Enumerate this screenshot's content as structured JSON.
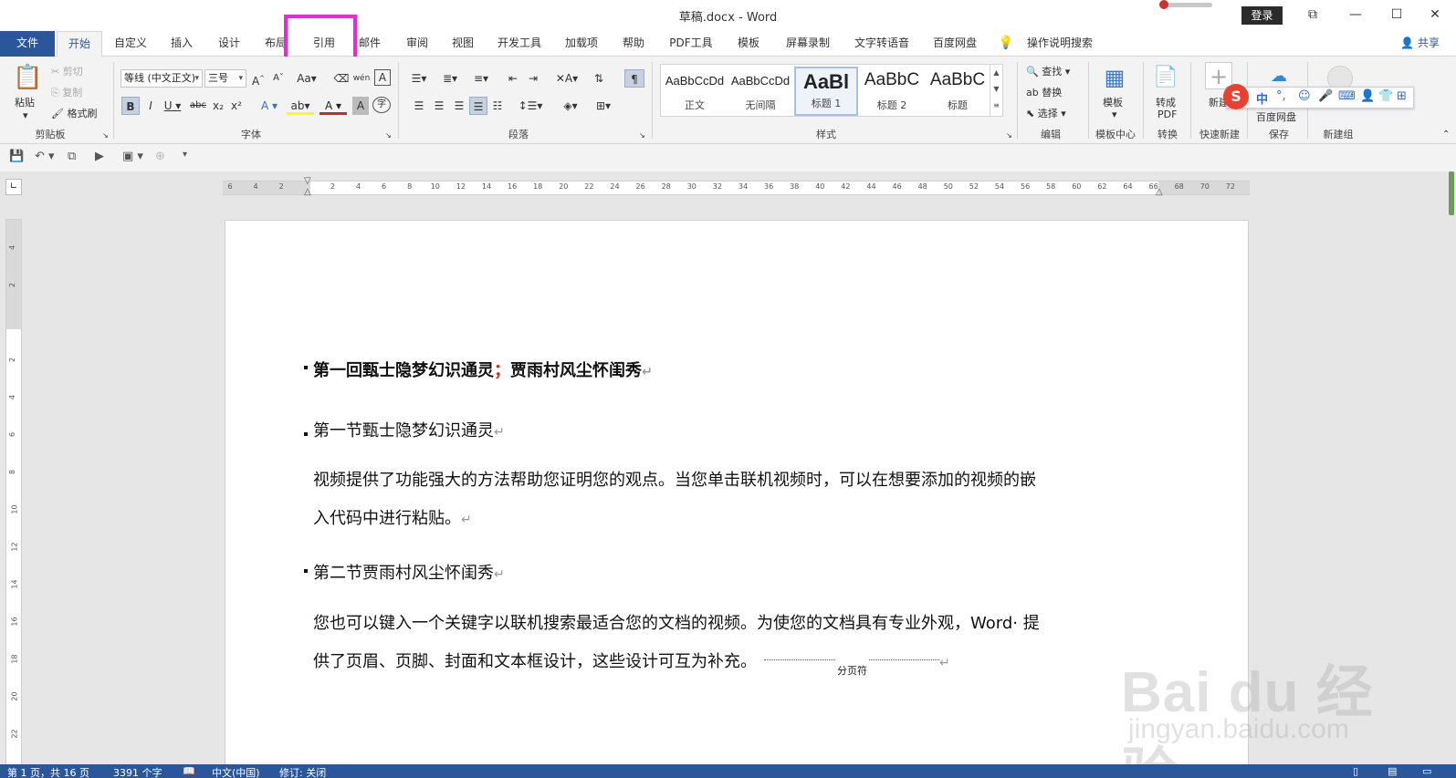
{
  "titlebar": {
    "title": "草稿.docx  -  Word",
    "login": "登录",
    "restore_glyph": "⧉",
    "minimize_glyph": "—",
    "maximize_glyph": "☐",
    "close_glyph": "✕"
  },
  "tabs": {
    "file": "文件",
    "home": "开始",
    "customize": "自定义",
    "insert": "插入",
    "design": "设计",
    "layout": "布局",
    "references": "引用",
    "mailings": "邮件",
    "review": "审阅",
    "view": "视图",
    "developer": "开发工具",
    "addins": "加载项",
    "help": "帮助",
    "pdf": "PDF工具",
    "template": "模板",
    "screenrec": "屏幕录制",
    "tts": "文字转语音",
    "baidu": "百度网盘",
    "tellme": "操作说明搜索",
    "share": "共享"
  },
  "ribbon": {
    "clipboard": {
      "paste": "粘贴",
      "cut": "剪切",
      "copy": "复制",
      "format_painter": "格式刷",
      "label": "剪贴板"
    },
    "font": {
      "font_name": "等线 (中文正文)",
      "font_size": "三号",
      "label": "字体"
    },
    "paragraph": {
      "label": "段落"
    },
    "styles": {
      "label": "样式",
      "items": [
        {
          "sample": "AaBbCcDd",
          "name": "正文"
        },
        {
          "sample": "AaBbCcDd",
          "name": "无间隔"
        },
        {
          "sample": "AaBl",
          "name": "标题 1"
        },
        {
          "sample": "AaBbC",
          "name": "标题 2"
        },
        {
          "sample": "AaBbC",
          "name": "标题"
        }
      ]
    },
    "editing": {
      "find": "查找",
      "replace": "替换",
      "select": "选择",
      "label": "编辑"
    },
    "template_center": {
      "btn": "模板",
      "label": "模板中心"
    },
    "convert": {
      "btn1": "转成",
      "btn2": "PDF",
      "label": "转换"
    },
    "quick_new": {
      "btn": "新建",
      "label": "快速新建"
    },
    "save": {
      "btn": "百度网盘",
      "label": "保存"
    },
    "new_group": {
      "label": "新建组"
    }
  },
  "ime": {
    "logo": "S",
    "mode": "中"
  },
  "ruler": {
    "h_ticks": [
      "6",
      "4",
      "2",
      "",
      "2",
      "4",
      "6",
      "8",
      "10",
      "12",
      "14",
      "16",
      "18",
      "20",
      "22",
      "24",
      "26",
      "28",
      "30",
      "32",
      "34",
      "36",
      "38",
      "40",
      "42",
      "44",
      "46",
      "48",
      "50",
      "52",
      "54",
      "56",
      "58",
      "60",
      "62",
      "64",
      "66",
      "68",
      "70",
      "72"
    ],
    "v_ticks": [
      "4",
      "2",
      "",
      "2",
      "4",
      "6",
      "8",
      "10",
      "12",
      "14",
      "16",
      "18",
      "20",
      "22"
    ]
  },
  "document": {
    "heading1_a": "第一回甄士隐梦幻识通灵",
    "heading1_semi": "；",
    "heading1_b": "贾雨村风尘怀闺秀",
    "section1": "第一节甄士隐梦幻识通灵",
    "para1_line1": "视频提供了功能强大的方法帮助您证明您的观点。当您单击联机视频时，可以在想要添加的视频的嵌",
    "para1_line2": "入代码中进行粘贴。",
    "section2": "第二节贾雨村风尘怀闺秀",
    "para2_line1": "您也可以键入一个关键字以联机搜索最适合您的文档的视频。为使您的文档具有专业外观，Word· 提",
    "para2_line2": "供了页眉、页脚、封面和文本框设计，这些设计可互为补充。",
    "page_break": "分页符",
    "para_mark": "↵"
  },
  "watermark": {
    "main": "Bai du 经验",
    "sub": "jingyan.baidu.com"
  },
  "statusbar": {
    "page": "第 1 页，共 16 页",
    "words": "3391 个字",
    "language": "中文(中国)",
    "track": "修订: 关闭"
  }
}
